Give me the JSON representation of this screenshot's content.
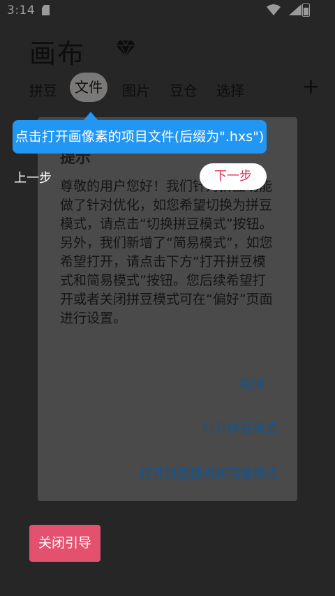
{
  "status_bar": {
    "time": "3:14"
  },
  "app": {
    "title": "画布"
  },
  "tabs": [
    {
      "label": "拼豆"
    },
    {
      "label": "文件"
    },
    {
      "label": "图片"
    },
    {
      "label": "豆仓"
    },
    {
      "label": "选择"
    }
  ],
  "dialog": {
    "title": "提示",
    "body": "尊敬的用户您好！我们针对拼豆功能做了针对优化，如您希望切换为拼豆模式，请点击“切换拼豆模式”按钮。另外，我们新增了“简易模式”，如您希望打开，请点击下方“打开拼豆模式和简易模式”按钮。您后续希望打开或者关闭拼豆模式可在“偏好”页面进行设置。",
    "cancel": "取消",
    "open_bead_mode": "打开拼豆模式",
    "open_bead_and_simple_mode": "打开拼豆模式和简易模式"
  },
  "guide": {
    "tooltip": "点击打开画像素的项目文件(后缀为\".hxs\")",
    "prev_step": "上一步",
    "next_step": "下一步",
    "close_guide": "关闭引导"
  },
  "colors": {
    "tooltip_blue": "#2196f3",
    "close_button_pink": "#e4516f",
    "next_step_text": "#e1305c"
  }
}
